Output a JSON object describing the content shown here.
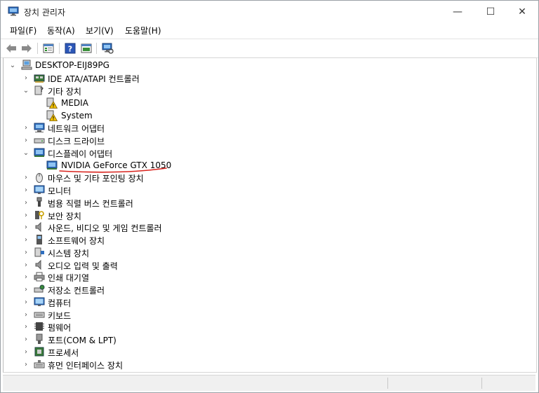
{
  "window": {
    "title": "장치 관리자"
  },
  "window_controls": {
    "minimize": "—",
    "maximize": "☐",
    "close": "✕"
  },
  "menu": [
    "파일(F)",
    "동작(A)",
    "보기(V)",
    "도움말(H)"
  ],
  "toolbar": [
    "back",
    "forward",
    "properties",
    "help",
    "update-driver",
    "scan-hardware"
  ],
  "tree": {
    "root": "DESKTOP-EIJ89PG",
    "items": [
      {
        "label": "IDE ATA/ATAPI 컨트롤러",
        "icon": "ide-controller-icon",
        "expanded": false
      },
      {
        "label": "기타 장치",
        "icon": "other-devices-icon",
        "expanded": true
      },
      {
        "label": "MEDIA",
        "icon": "warning-device-icon",
        "child": true
      },
      {
        "label": "System",
        "icon": "warning-device-icon",
        "child": true
      },
      {
        "label": "네트워크 어댑터",
        "icon": "network-adapter-icon",
        "expanded": false
      },
      {
        "label": "디스크 드라이브",
        "icon": "disk-drive-icon",
        "expanded": false
      },
      {
        "label": "디스플레이 어댑터",
        "icon": "display-adapter-icon",
        "expanded": true
      },
      {
        "label": "NVIDIA GeForce GTX 1050",
        "icon": "gpu-icon",
        "child": true
      },
      {
        "label": "마우스 및 기타 포인팅 장치",
        "icon": "mouse-icon",
        "expanded": false
      },
      {
        "label": "모니터",
        "icon": "monitor-icon",
        "expanded": false
      },
      {
        "label": "범용 직렬 버스 컨트롤러",
        "icon": "usb-icon",
        "expanded": false
      },
      {
        "label": "보안 장치",
        "icon": "security-device-icon",
        "expanded": false
      },
      {
        "label": "사운드, 비디오 및 게임 컨트롤러",
        "icon": "sound-icon",
        "expanded": false
      },
      {
        "label": "소프트웨어 장치",
        "icon": "software-device-icon",
        "expanded": false
      },
      {
        "label": "시스템 장치",
        "icon": "system-device-icon",
        "expanded": false
      },
      {
        "label": "오디오 입력 및 출력",
        "icon": "audio-io-icon",
        "expanded": false
      },
      {
        "label": "인쇄 대기열",
        "icon": "print-queue-icon",
        "expanded": false
      },
      {
        "label": "저장소 컨트롤러",
        "icon": "storage-controller-icon",
        "expanded": false
      },
      {
        "label": "컴퓨터",
        "icon": "computer-icon",
        "expanded": false
      },
      {
        "label": "키보드",
        "icon": "keyboard-icon",
        "expanded": false
      },
      {
        "label": "펌웨어",
        "icon": "firmware-icon",
        "expanded": false
      },
      {
        "label": "포트(COM & LPT)",
        "icon": "port-icon",
        "expanded": false
      },
      {
        "label": "프로세서",
        "icon": "processor-icon",
        "expanded": false
      },
      {
        "label": "휴먼 인터페이스 장치",
        "icon": "hid-icon",
        "expanded": false
      }
    ]
  },
  "annotation": {
    "color": "#d9231d"
  }
}
